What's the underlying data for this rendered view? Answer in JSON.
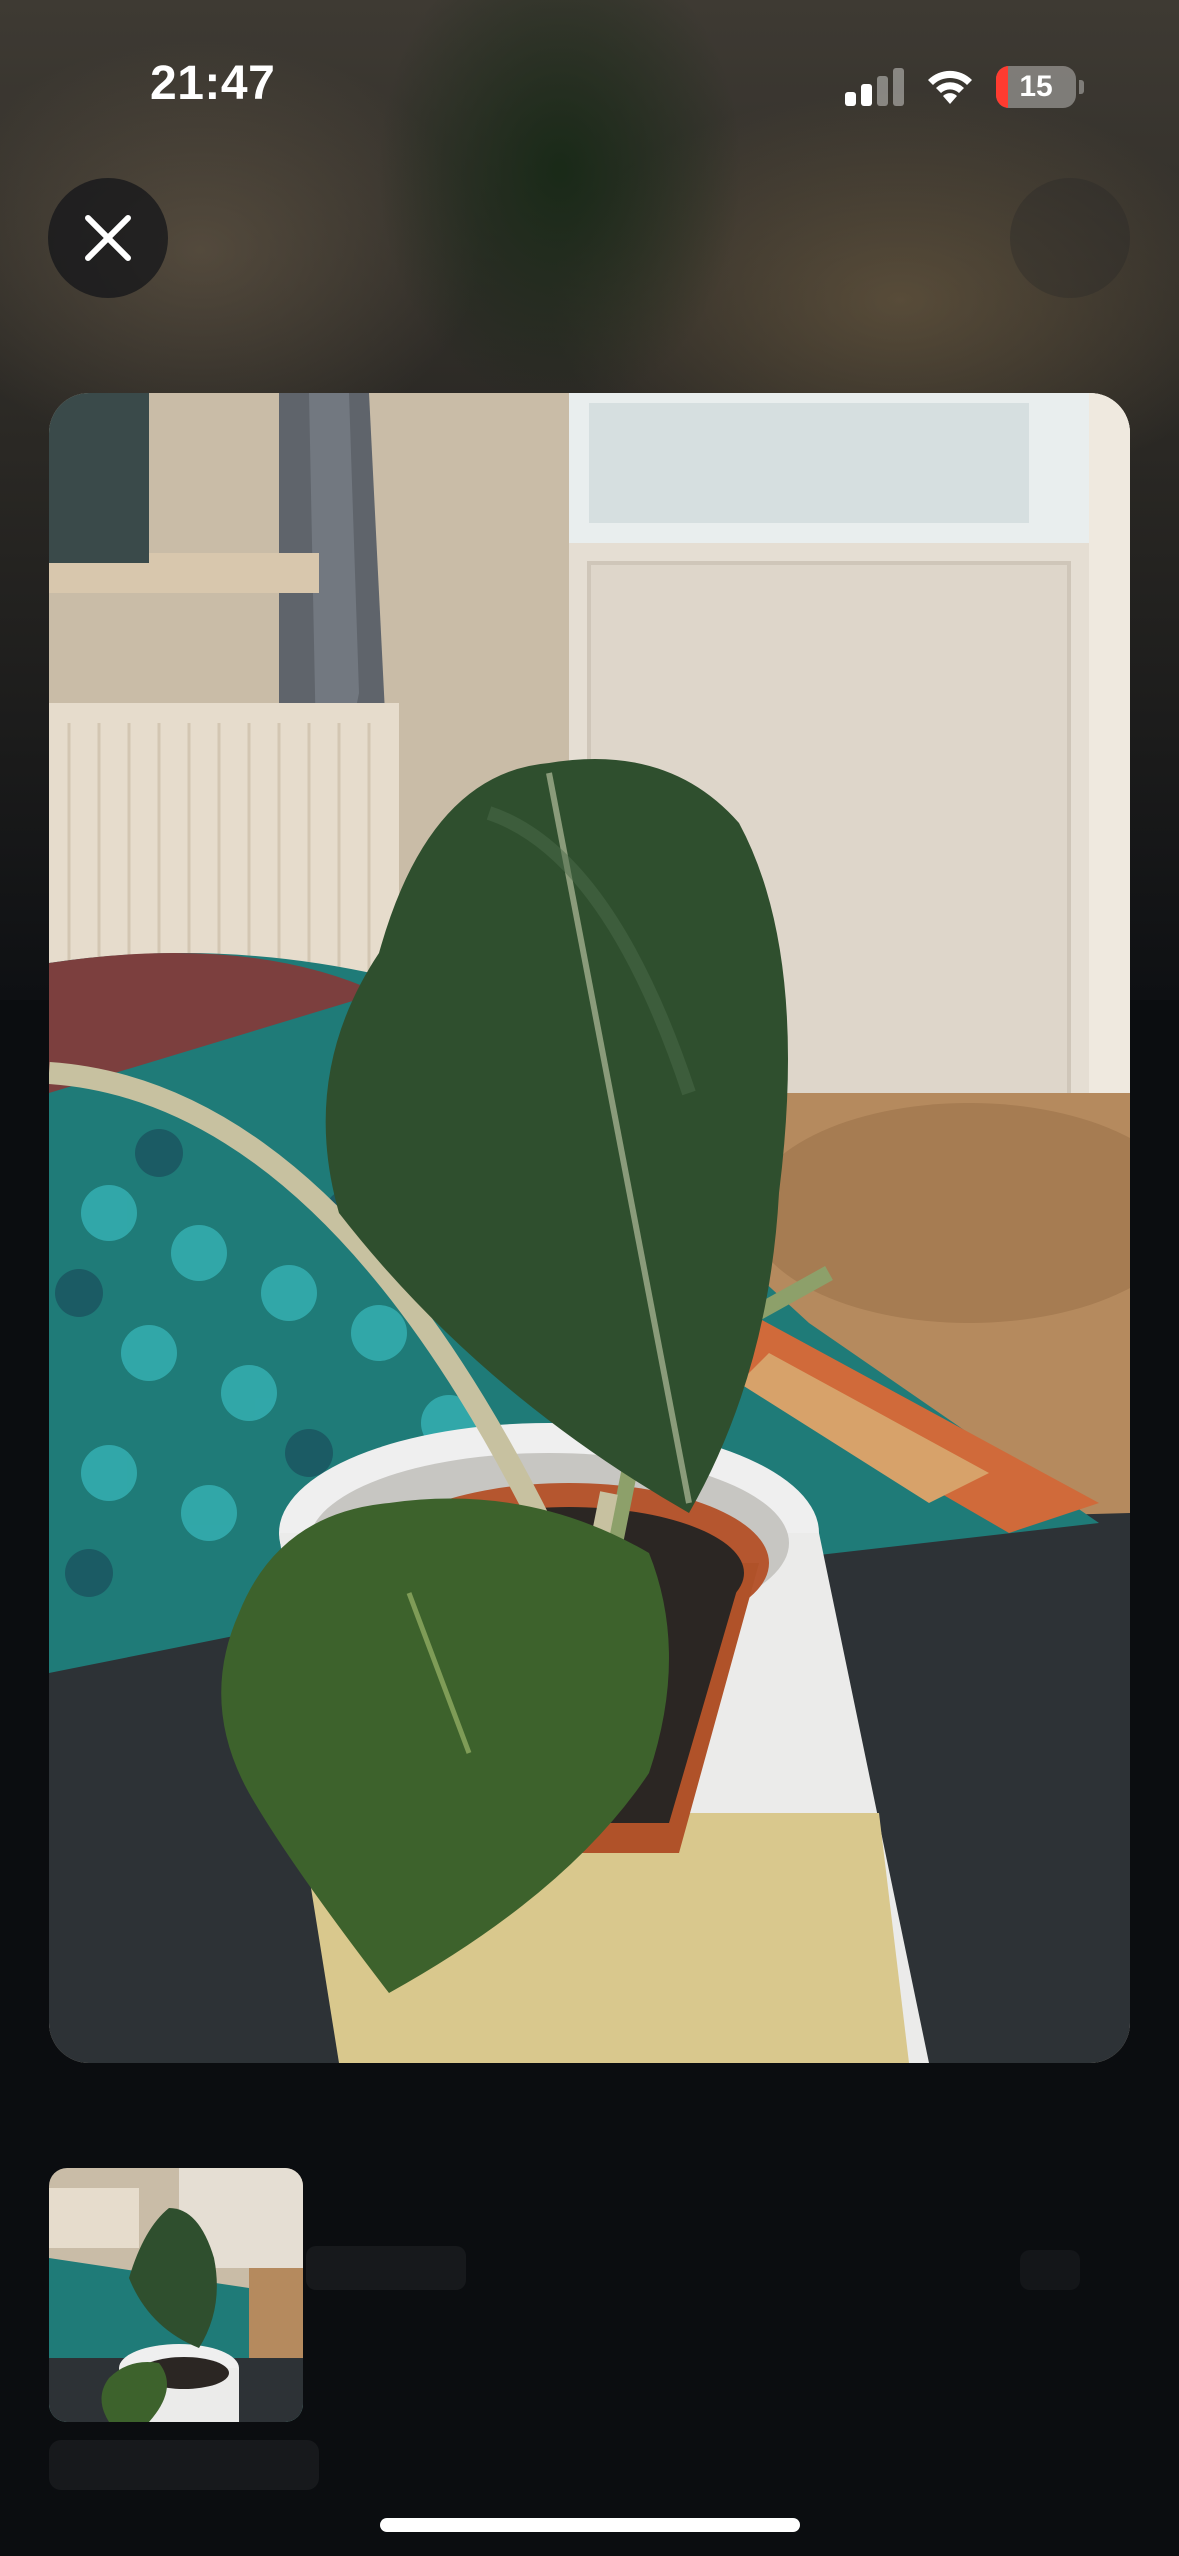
{
  "status_bar": {
    "time": "21:47",
    "battery_level": "15",
    "signal_icon": "cellular-signal-icon",
    "wifi_icon": "wifi-icon",
    "battery_icon": "battery-icon"
  },
  "toolbar": {
    "close_icon": "close-icon"
  },
  "colors": {
    "battery_low": "#ff3b30",
    "background": "#0b0d10",
    "accent_white": "#ffffff"
  }
}
